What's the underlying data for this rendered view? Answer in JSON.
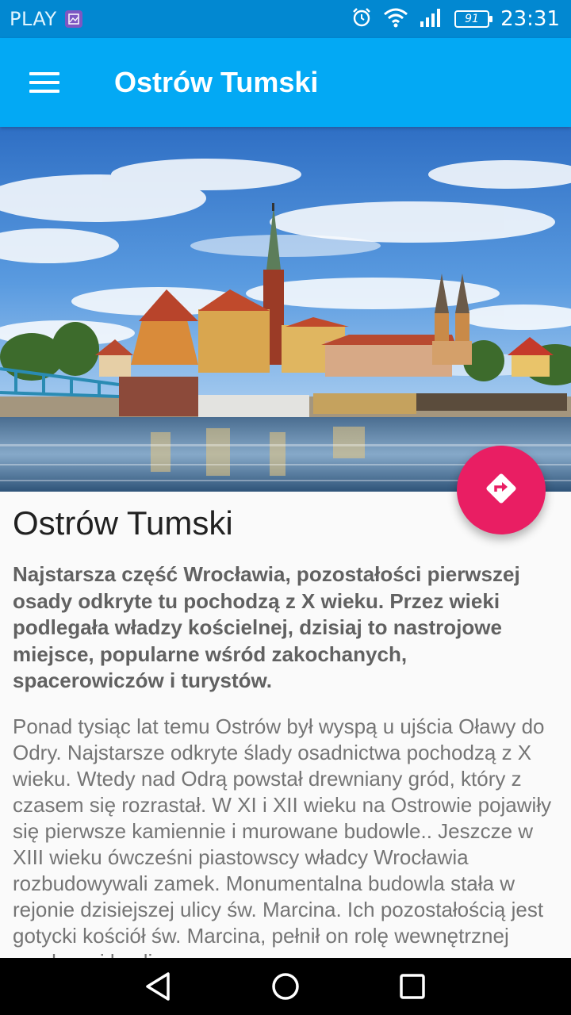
{
  "status_bar": {
    "carrier": "PLAY",
    "battery": "91",
    "time": "23:31",
    "icons": [
      "gallery-icon",
      "alarm-icon",
      "wifi-icon",
      "signal-icon",
      "battery-icon"
    ]
  },
  "app_bar": {
    "title": "Ostrów Tumski",
    "menu_icon": "hamburger-menu-icon"
  },
  "hero": {
    "image": "cathedral-island-panorama"
  },
  "fab": {
    "icon": "directions-icon",
    "color": "#e91e63"
  },
  "article": {
    "title": "Ostrów Tumski",
    "lead": "Najstarsza część Wrocławia, pozostałości pierwszej osady odkryte tu pochodzą z X wieku. Przez wieki podlegała władzy kościelnej, dzisiaj to nastrojowe miejsce, popularne wśród zakochanych, spacerowiczów i turystów.",
    "body": "Ponad tysiąc lat temu Ostrów był wyspą u ujścia Oławy do Odry. Najstarsze odkryte ślady osadnictwa pochodzą z X wieku. Wtedy nad Odrą powstał drewniany gród, który z czasem się rozrastał. W XI i XII wieku na Ostrowie pojawiły się pierwsze kamiennie i murowane budowle.. Jeszcze w XIII wieku ówcześni piastowscy władcy Wrocławia rozbudowywali zamek. Monumentalna budowla stała w rejonie dzisiejszej ulicy św. Marcina. Ich pozostałością jest gotycki kościół św. Marcina, pełnił on rolę wewnętrznej zamkowej kaplicy."
  },
  "colors": {
    "status_bar": "#0288d1",
    "app_bar": "#03a9f4",
    "accent": "#e91e63"
  },
  "nav_bar": {
    "buttons": [
      "back-icon",
      "home-icon",
      "recents-icon"
    ]
  }
}
